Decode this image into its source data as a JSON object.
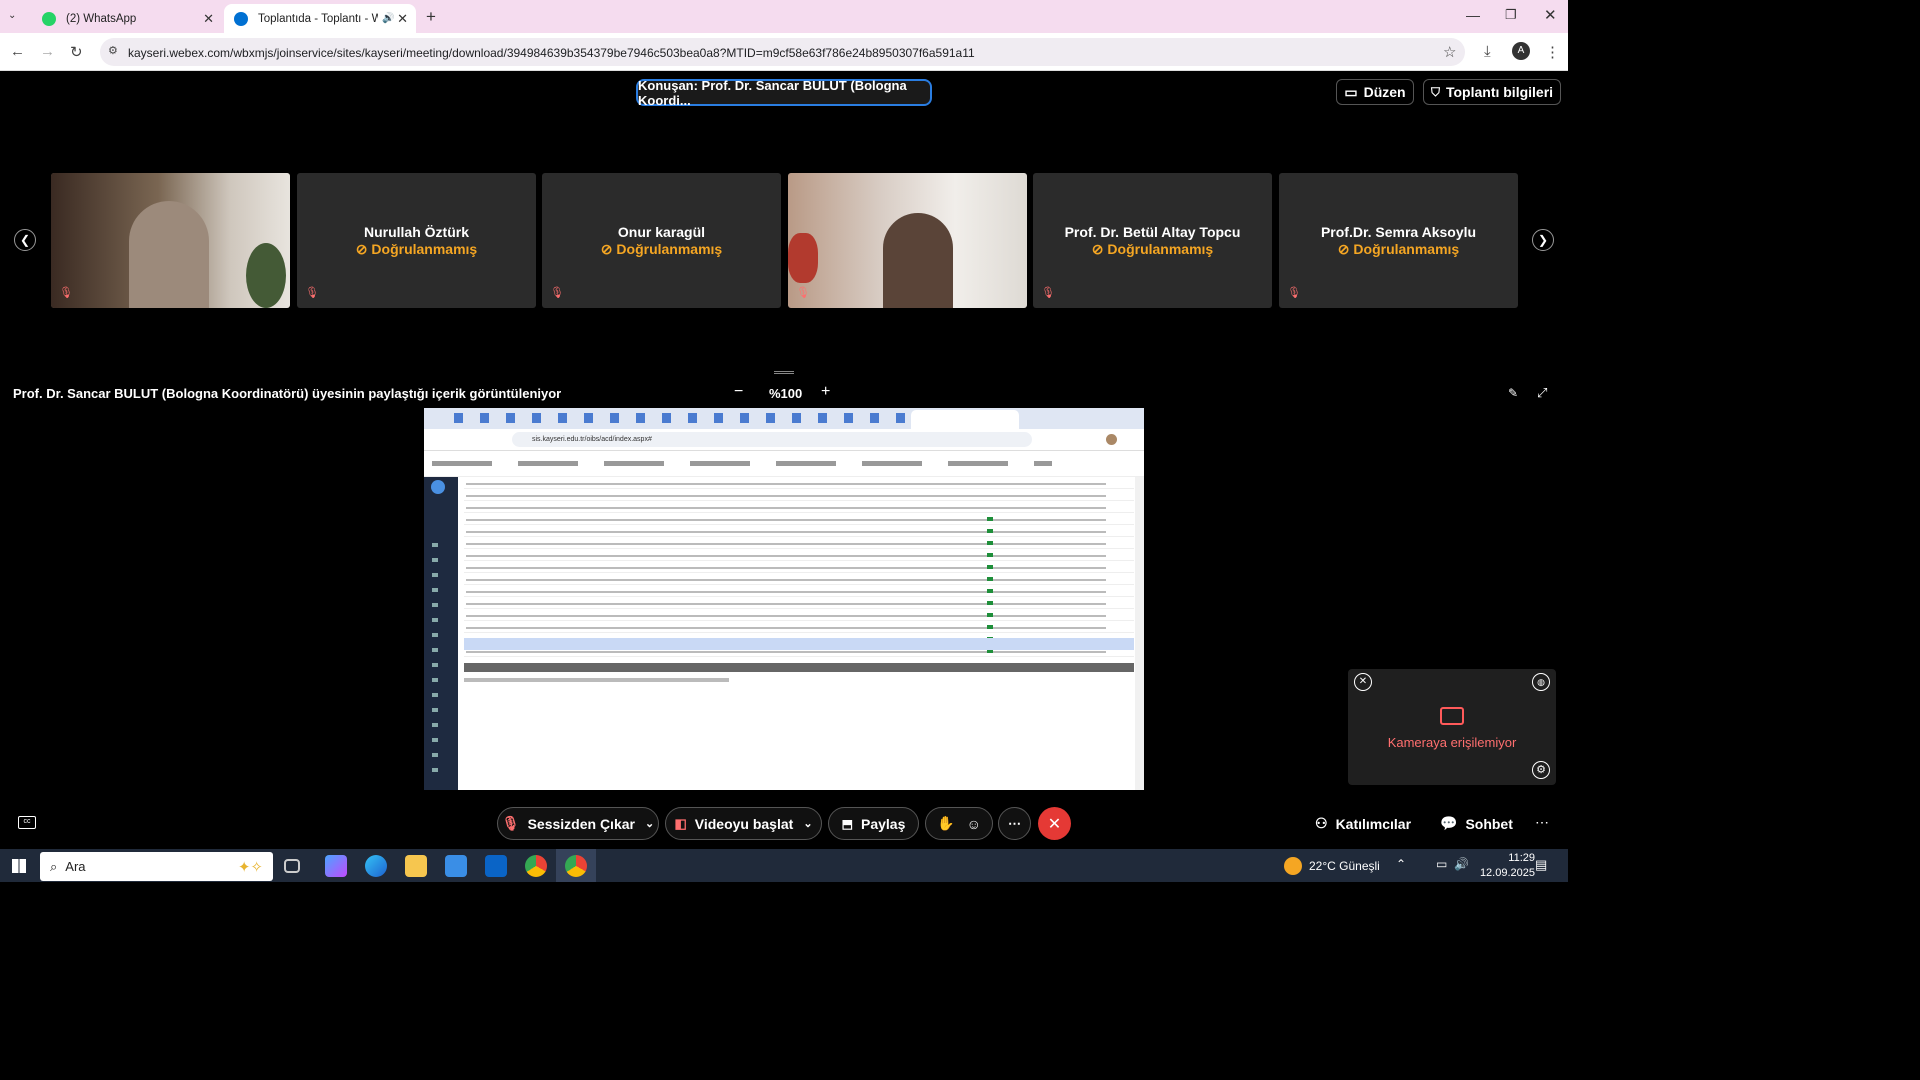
{
  "tabs": [
    {
      "title": "(2) WhatsApp"
    },
    {
      "title": "Toplantıda - Toplantı - Webe"
    }
  ],
  "url": "kayseri.webex.com/wbxmjs/joinservice/sites/kayseri/meeting/download/394984639b354379be7946c503bea0a8?MTID=m9cf58e63f786e24b8950307f6a591a11",
  "speaking": "Konuşan: Prof. Dr. Sancar BULUT (Bologna Koordi...",
  "top_buttons": {
    "layout": "Düzen",
    "info": "Toplantı bilgileri"
  },
  "participants": [
    {
      "name": "",
      "status": ""
    },
    {
      "name": "Nurullah Öztürk",
      "status": "⊘ Doğrulanmamış"
    },
    {
      "name": "Onur karagül",
      "status": "⊘ Doğrulanmamış"
    },
    {
      "name": "",
      "status": ""
    },
    {
      "name": "Prof. Dr. Betül Altay Topcu",
      "status": "⊘ Doğrulanmamış"
    },
    {
      "name": "Prof.Dr. Semra Aksoylu",
      "status": "⊘ Doğrulanmamış"
    }
  ],
  "share_caption": "Prof. Dr. Sancar BULUT (Bologna Koordinatörü) üyesinin paylaştığı içerik görüntüleniyor",
  "zoom": "%100",
  "shared_url": "sis.kayseri.edu.tr/oibs/acd/index.aspx#",
  "self_view": {
    "label": "Kameraya erişilemiyor"
  },
  "controls": {
    "mute": "Sessizden Çıkar",
    "video": "Videoyu başlat",
    "share": "Paylaş",
    "participants": "Katılımcılar",
    "chat": "Sohbet"
  },
  "taskbar": {
    "search": "Ara",
    "weather": "22°C  Güneşli",
    "time": "11:29",
    "date": "12.09.2025"
  },
  "colors": {
    "accent": "#2a7de1",
    "warning": "#f5a623",
    "danger": "#e53935"
  }
}
